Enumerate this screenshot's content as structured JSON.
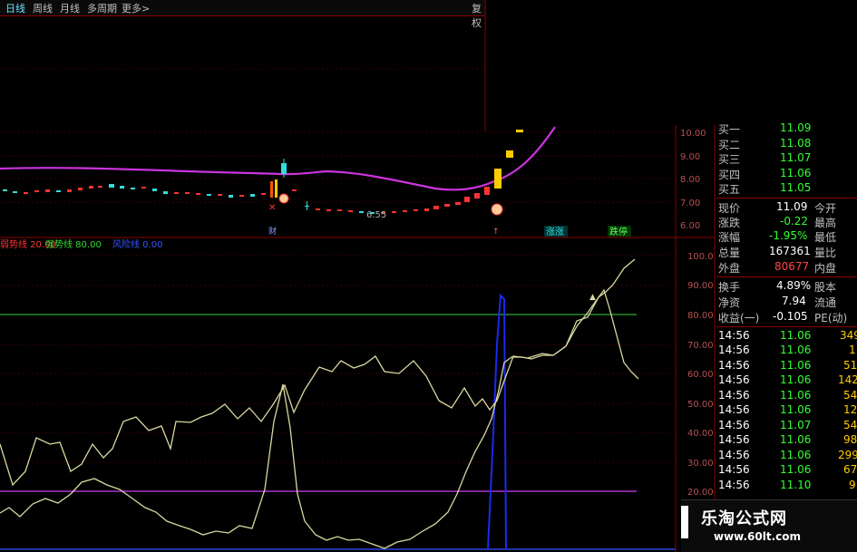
{
  "toolbar": {
    "tabs": [
      "日线",
      "周线",
      "月线",
      "多周期",
      "更多>"
    ],
    "right_label": "复权"
  },
  "price_axis_labels": [
    "10.00",
    "9.00",
    "8.00",
    "7.00",
    "6.00"
  ],
  "indicator_axis_labels": [
    "100.0",
    "90.00",
    "80.00",
    "70.00",
    "60.00",
    "50.00",
    "40.00",
    "30.00",
    "20.00"
  ],
  "main_chart": {
    "min_label": "6.55",
    "event_markers": {
      "cai": "财",
      "up": "↑"
    },
    "tags": {
      "rise": "涨涨",
      "fall": "跌停"
    },
    "colors": {
      "ma": "#cc33dd",
      "up": "#ff3333",
      "down": "#33dddd",
      "limit": "#ffcc00"
    }
  },
  "indicator": {
    "legend": [
      {
        "label": "弱势线 20.00",
        "color": "#ff3333"
      },
      {
        "label": "强势线 80.00",
        "color": "#33dd33"
      },
      {
        "label": "风险线 0.00",
        "color": "#3333ff"
      }
    ],
    "colors": {
      "line": "#d8d8a0",
      "spike": "#1a2aee",
      "strong": "#33aa33",
      "weak": "#aa33cc"
    }
  },
  "quote_panel": {
    "bids": [
      {
        "label": "买一",
        "value": "11.09"
      },
      {
        "label": "买二",
        "value": "11.08"
      },
      {
        "label": "买三",
        "value": "11.07"
      },
      {
        "label": "买四",
        "value": "11.06"
      },
      {
        "label": "买五",
        "value": "11.05"
      }
    ],
    "stats": [
      {
        "label": "现价",
        "value": "11.09",
        "label2": "今开",
        "color": "#ffffff"
      },
      {
        "label": "涨跌",
        "value": "-0.22",
        "label2": "最高",
        "color": "#33ff33"
      },
      {
        "label": "涨幅",
        "value": "-1.95%",
        "label2": "最低",
        "color": "#33ff33"
      },
      {
        "label": "总量",
        "value": "167361",
        "label2": "量比",
        "color": "#ffffff"
      },
      {
        "label": "外盘",
        "value": "80677",
        "label2": "内盘",
        "color": "#ff4444"
      }
    ],
    "stats2": [
      {
        "label": "换手",
        "value": "4.89%",
        "label2": "股本"
      },
      {
        "label": "净资",
        "value": "7.94",
        "label2": "流通"
      },
      {
        "label": "收益(一)",
        "value": "-0.105",
        "label2": "PE(动)"
      }
    ],
    "ticks": [
      {
        "time": "14:56",
        "price": "11.06",
        "vol": "349"
      },
      {
        "time": "14:56",
        "price": "11.06",
        "vol": "1"
      },
      {
        "time": "14:56",
        "price": "11.06",
        "vol": "51"
      },
      {
        "time": "14:56",
        "price": "11.06",
        "vol": "142"
      },
      {
        "time": "14:56",
        "price": "11.06",
        "vol": "54"
      },
      {
        "time": "14:56",
        "price": "11.06",
        "vol": "12"
      },
      {
        "time": "14:56",
        "price": "11.07",
        "vol": "54"
      },
      {
        "time": "14:56",
        "price": "11.06",
        "vol": "98"
      },
      {
        "time": "14:56",
        "price": "11.06",
        "vol": "299"
      },
      {
        "time": "14:56",
        "price": "11.06",
        "vol": "67"
      },
      {
        "time": "14:56",
        "price": "11.10",
        "vol": "9"
      }
    ]
  },
  "watermark": {
    "title": "乐淘公式网",
    "url": "www.60lt.com"
  }
}
